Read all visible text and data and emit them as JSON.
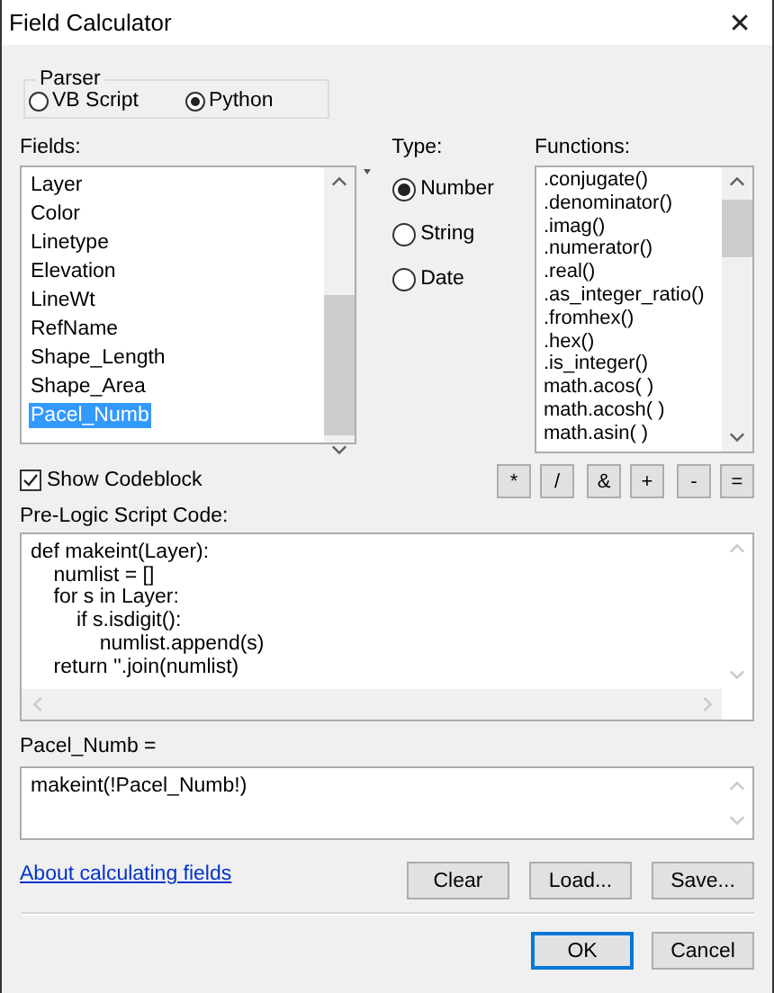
{
  "window": {
    "title": "Field Calculator",
    "close": "✕"
  },
  "parser": {
    "title": "Parser",
    "options": [
      {
        "label": "VB Script",
        "selected": false
      },
      {
        "label": "Python",
        "selected": true
      }
    ]
  },
  "fields": {
    "label": "Fields:",
    "items": [
      {
        "label": "Layer",
        "selected": false
      },
      {
        "label": "Color",
        "selected": false
      },
      {
        "label": "Linetype",
        "selected": false
      },
      {
        "label": "Elevation",
        "selected": false
      },
      {
        "label": "LineWt",
        "selected": false
      },
      {
        "label": "RefName",
        "selected": false
      },
      {
        "label": "Shape_Length",
        "selected": false
      },
      {
        "label": "Shape_Area",
        "selected": false
      },
      {
        "label": "Pacel_Numb",
        "selected": true
      }
    ]
  },
  "type": {
    "label": "Type:",
    "options": [
      {
        "label": "Number",
        "selected": true
      },
      {
        "label": "String",
        "selected": false
      },
      {
        "label": "Date",
        "selected": false
      }
    ]
  },
  "functions": {
    "label": "Functions:",
    "items": [
      ".conjugate()",
      ".denominator()",
      ".imag()",
      ".numerator()",
      ".real()",
      ".as_integer_ratio()",
      ".fromhex()",
      ".hex()",
      ".is_integer()",
      "math.acos( )",
      "math.acosh( )",
      "math.asin( )"
    ]
  },
  "show_codeblock": {
    "label": "Show Codeblock",
    "checked": true
  },
  "operators": [
    "*",
    "/",
    "&",
    "+",
    "-",
    "="
  ],
  "pre_logic": {
    "label": "Pre-Logic Script Code:",
    "code": "def makeint(Layer):\n    numlist = []\n    for s in Layer:\n        if s.isdigit():\n            numlist.append(s)\n    return ''.join(numlist)"
  },
  "expression": {
    "label": "Pacel_Numb =",
    "value": "makeint(!Pacel_Numb!)"
  },
  "help_link": "About calculating fields",
  "file_buttons": [
    "Clear",
    "Load...",
    "Save..."
  ],
  "dialog_buttons": [
    {
      "label": "OK",
      "default": true
    },
    {
      "label": "Cancel",
      "default": false
    }
  ]
}
